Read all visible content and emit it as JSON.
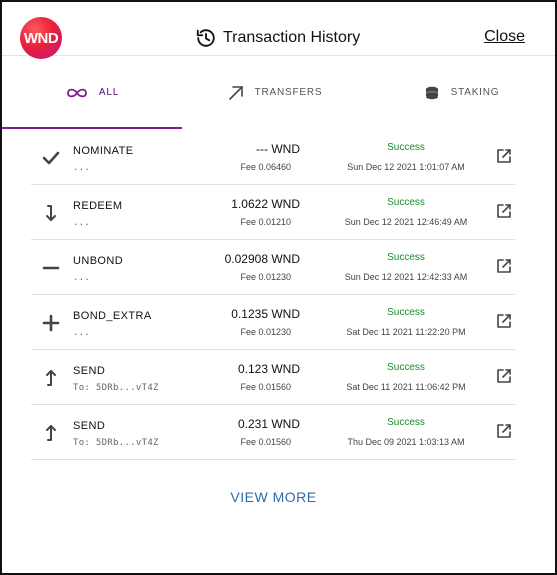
{
  "header": {
    "logo_text": "WND",
    "title": "Transaction History",
    "close_label": "Close"
  },
  "tabs": [
    {
      "label": "ALL",
      "icon": "infinity-icon",
      "active": true
    },
    {
      "label": "TRANSFERS",
      "icon": "arrow-up-right-icon",
      "active": false
    },
    {
      "label": "STAKING",
      "icon": "coins-icon",
      "active": false
    }
  ],
  "transactions": [
    {
      "type": "NOMINATE",
      "sub": "...",
      "amount": "--- WND",
      "fee": "Fee 0.06460",
      "status": "Success",
      "date": "Sun Dec 12 2021 1:01:07 AM",
      "icon": "check-icon"
    },
    {
      "type": "REDEEM",
      "sub": "...",
      "amount": "1.0622 WND",
      "fee": "Fee 0.01210",
      "status": "Success",
      "date": "Sun Dec 12 2021 12:46:49 AM",
      "icon": "redeem-arrow-icon"
    },
    {
      "type": "UNBOND",
      "sub": "...",
      "amount": "0.02908 WND",
      "fee": "Fee 0.01230",
      "status": "Success",
      "date": "Sun Dec 12 2021 12:42:33 AM",
      "icon": "minus-icon"
    },
    {
      "type": "BOND_EXTRA",
      "sub": "...",
      "amount": "0.1235 WND",
      "fee": "Fee 0.01230",
      "status": "Success",
      "date": "Sat Dec 11 2021 11:22:20 PM",
      "icon": "plus-icon"
    },
    {
      "type": "SEND",
      "sub": "To: 5DRb...vT4Z",
      "amount": "0.123 WND",
      "fee": "Fee 0.01560",
      "status": "Success",
      "date": "Sat Dec 11 2021 11:06:42 PM",
      "icon": "send-arrow-icon"
    },
    {
      "type": "SEND",
      "sub": "To: 5DRb...vT4Z",
      "amount": "0.231 WND",
      "fee": "Fee 0.01560",
      "status": "Success",
      "date": "Thu Dec 09 2021 1:03:13 AM",
      "icon": "send-arrow-icon"
    }
  ],
  "footer": {
    "view_more_label": "VIEW MORE"
  },
  "colors": {
    "accent": "#7a1e8e",
    "success": "#1a8a2a",
    "link": "#2f6aa9"
  }
}
